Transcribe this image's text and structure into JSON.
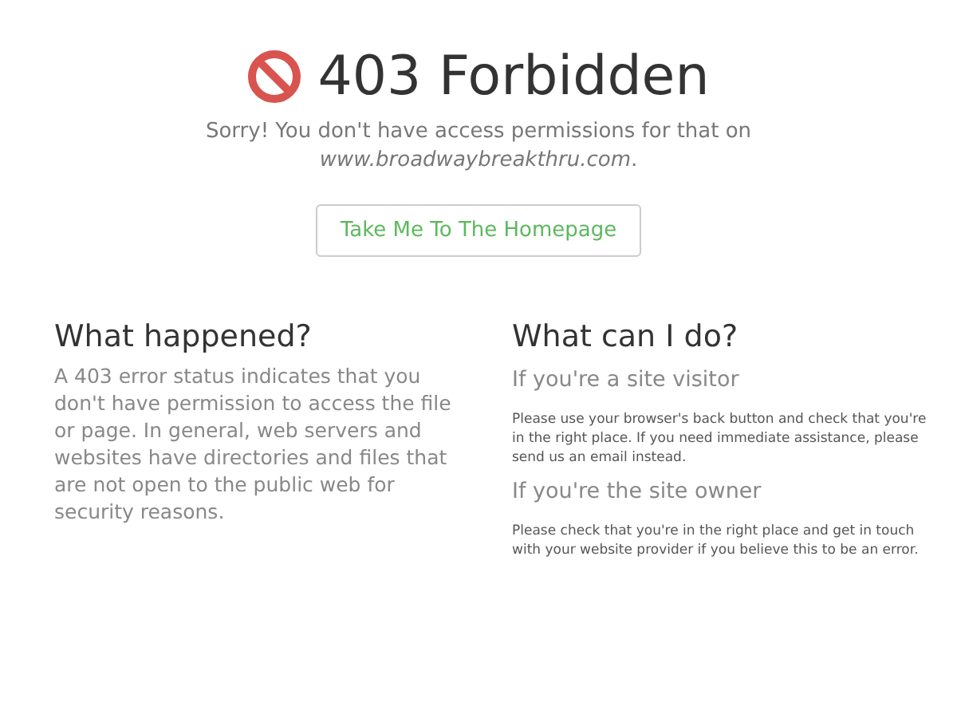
{
  "header": {
    "title": "403 Forbidden",
    "message": "Sorry! You don't have access permissions for that on *www.broadwaybreakthru.com*.",
    "button": "Take Me To The Homepage"
  },
  "left": {
    "heading": "What happened?",
    "body": "A 403 error status indicates that you don't have permission to access the file or page. In general, web servers and websites have directories and files that are not open to the public web for security reasons."
  },
  "right": {
    "heading": "What can I do?",
    "sections": [
      {
        "subheading": "If you're a site visitor",
        "body": "Please use your browser's back button and check that you're in the right place. If you need immediate assistance, please send us an email instead."
      },
      {
        "subheading": "If you're the site owner",
        "body": "Please check that you're in the right place and get in touch with your website provider if you believe this to be an error."
      }
    ]
  }
}
